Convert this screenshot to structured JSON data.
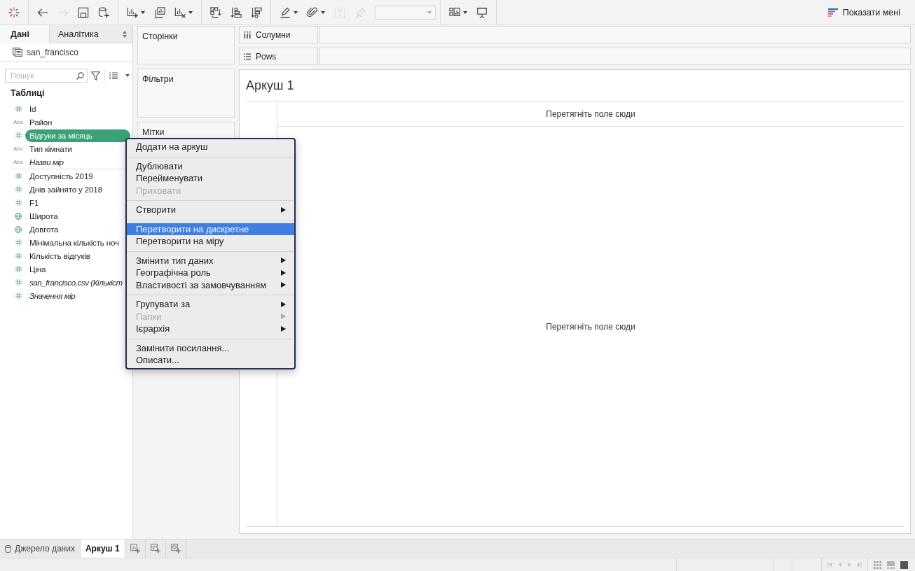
{
  "toolbar": {
    "groups": [
      {
        "buttons": [
          {
            "kind": "button",
            "disabled": false,
            "dropdown": false
          }
        ]
      },
      {
        "buttons": [
          {
            "kind": "button",
            "disabled": false,
            "dropdown": false
          },
          {
            "kind": "button",
            "disabled": true,
            "dropdown": false
          },
          {
            "kind": "button",
            "disabled": false,
            "dropdown": false
          },
          {
            "kind": "button",
            "disabled": false,
            "dropdown": false
          }
        ]
      },
      {
        "buttons": [
          {
            "kind": "button",
            "disabled": false,
            "dropdown": true
          },
          {
            "kind": "button",
            "disabled": false,
            "dropdown": false
          },
          {
            "kind": "button",
            "disabled": false,
            "dropdown": true
          }
        ]
      },
      {
        "buttons": [
          {
            "kind": "button",
            "disabled": false,
            "dropdown": false
          },
          {
            "kind": "button",
            "disabled": false,
            "dropdown": false
          },
          {
            "kind": "button",
            "disabled": false,
            "dropdown": false
          }
        ]
      },
      {
        "buttons": [
          {
            "kind": "button",
            "disabled": false,
            "dropdown": true
          },
          {
            "kind": "button",
            "disabled": false,
            "dropdown": true
          },
          {
            "kind": "button",
            "disabled": true,
            "dropdown": false
          },
          {
            "kind": "button",
            "disabled": true,
            "dropdown": false
          },
          {
            "kind": "combo",
            "disabled": true
          }
        ]
      },
      {
        "buttons": [
          {
            "kind": "button",
            "disabled": false,
            "dropdown": true
          },
          {
            "kind": "button",
            "disabled": false,
            "dropdown": false
          }
        ]
      }
    ],
    "show_me": "Показати мені"
  },
  "data_pane": {
    "tabs": [
      {
        "label": "Дані",
        "selected": true
      },
      {
        "label": "Аналітика",
        "selected": false
      }
    ],
    "data_source": "san_francisco",
    "search": {
      "placeholder": "Пошук"
    },
    "section": "Таблиці",
    "field_groups": [
      {
        "fields": [
          {
            "name": "Id",
            "kind": "number",
            "italic": false,
            "selected": false
          },
          {
            "name": "Район",
            "kind": "text",
            "type_label": "Abc",
            "italic": false,
            "selected": false
          },
          {
            "name": "Відгуки за місяць",
            "kind": "number",
            "italic": false,
            "selected": true
          },
          {
            "name": "Тип кімнати",
            "kind": "text",
            "type_label": "Abc",
            "italic": false,
            "selected": false
          },
          {
            "name": "Назви мір",
            "kind": "text",
            "type_label": "Abc",
            "italic": true,
            "selected": false
          }
        ]
      },
      {
        "fields": [
          {
            "name": "Доступність 2019",
            "kind": "number",
            "italic": false,
            "selected": false
          },
          {
            "name": "Днів зайнято у 2018",
            "kind": "number",
            "italic": false,
            "selected": false
          },
          {
            "name": "F1",
            "kind": "number",
            "italic": false,
            "selected": false
          },
          {
            "name": "Широта",
            "kind": "geo",
            "italic": false,
            "selected": false
          },
          {
            "name": "Довгота",
            "kind": "geo",
            "italic": false,
            "selected": false
          },
          {
            "name": "Мінімальна кількість ноч",
            "kind": "number",
            "italic": false,
            "selected": false
          },
          {
            "name": "Кількість відгуків",
            "kind": "number",
            "italic": false,
            "selected": false
          },
          {
            "name": "Ціна",
            "kind": "number",
            "italic": false,
            "selected": false
          },
          {
            "name": "san_francisco.csv (Кількіст",
            "kind": "number",
            "italic": true,
            "selected": false
          },
          {
            "name": "Значення мір",
            "kind": "number",
            "italic": true,
            "selected": false
          }
        ]
      }
    ]
  },
  "shelf_cards": [
    {
      "title": "Сторінки"
    },
    {
      "title": "Фільтри"
    },
    {
      "title": "Мітки"
    }
  ],
  "shelves": [
    {
      "label": "Солумни"
    },
    {
      "label": "Pows"
    }
  ],
  "sheet": {
    "title": "Аркуш 1",
    "drop_hints": [
      "Перетягніть поле сюди",
      "Перетягніть поле сюди"
    ]
  },
  "context_menu": {
    "groups": [
      {
        "items": [
          {
            "label": "Додати на аркуш",
            "disabled": false,
            "selected": false,
            "submenu": false
          }
        ]
      },
      {
        "items": [
          {
            "label": "Дублювати",
            "disabled": false,
            "selected": false,
            "submenu": false
          },
          {
            "label": "Перейменувати",
            "disabled": false,
            "selected": false,
            "submenu": false
          },
          {
            "label": "Приховати",
            "disabled": true,
            "selected": false,
            "submenu": false
          }
        ]
      },
      {
        "items": [
          {
            "label": "Створити",
            "disabled": false,
            "selected": false,
            "submenu": true
          }
        ]
      },
      {
        "items": [
          {
            "label": "Перетворити на дискретне",
            "disabled": false,
            "selected": true,
            "submenu": false
          },
          {
            "label": "Перетворити на міру",
            "disabled": false,
            "selected": false,
            "submenu": false
          }
        ]
      },
      {
        "items": [
          {
            "label": "Змінити тип даних",
            "disabled": false,
            "selected": false,
            "submenu": true
          },
          {
            "label": "Географічна роль",
            "disabled": false,
            "selected": false,
            "submenu": true
          },
          {
            "label": "Властивості за замовчуванням",
            "disabled": false,
            "selected": false,
            "submenu": true
          }
        ]
      },
      {
        "items": [
          {
            "label": "Групувати за",
            "disabled": false,
            "selected": false,
            "submenu": true
          },
          {
            "label": "Папки",
            "disabled": true,
            "selected": false,
            "submenu": true
          },
          {
            "label": "Ієрархія",
            "disabled": false,
            "selected": false,
            "submenu": true
          }
        ]
      },
      {
        "items": [
          {
            "label": "Замінити посилання...",
            "disabled": false,
            "selected": false,
            "submenu": false
          },
          {
            "label": "Описати...",
            "disabled": false,
            "selected": false,
            "submenu": false
          }
        ]
      }
    ]
  },
  "sheet_tabs": [
    {
      "label": "Джерело даних",
      "kind": "data_source",
      "selected": false
    },
    {
      "label": "Аркуш 1",
      "kind": "sheet",
      "selected": true
    }
  ],
  "status_bar": {
    "nav_buttons": [
      {
        "disabled": true
      },
      {
        "disabled": true
      },
      {
        "disabled": true
      },
      {
        "disabled": true
      }
    ]
  }
}
